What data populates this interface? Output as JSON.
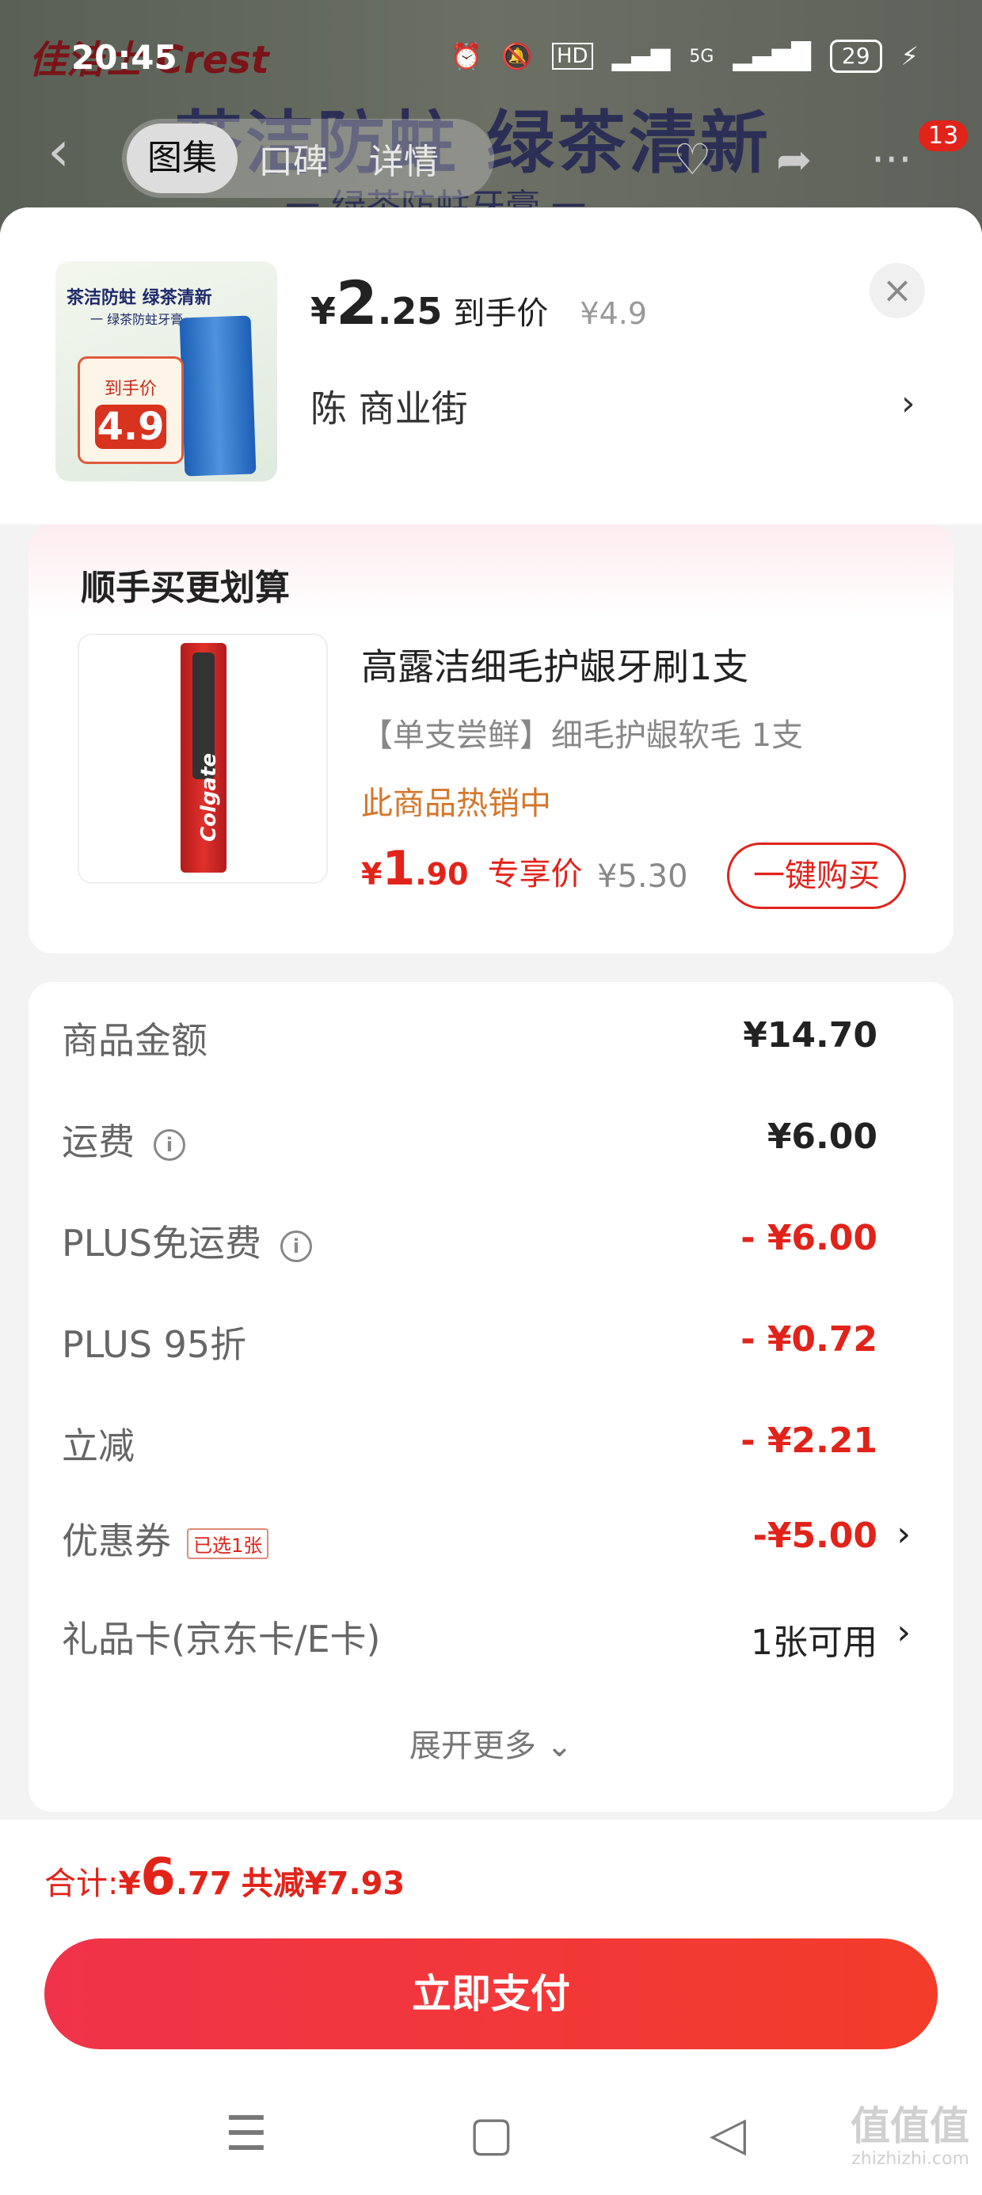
{
  "background": {
    "brand": "佳洁士 Crest",
    "banner": "茶洁防蛀  绿茶清新",
    "banner_sub": "一 绿茶防蛀牙膏 一"
  },
  "statusbar": {
    "time": "20:45",
    "battery": "29",
    "network": "5G"
  },
  "topnav": {
    "tabs": [
      "图集",
      "口碑",
      "详情"
    ],
    "active_tab": "图集",
    "badge": "13"
  },
  "product": {
    "image_title": "茶洁防蛀 绿茶清新",
    "image_sub": "一 绿茶防蛀牙膏 一",
    "image_tag_label": "到手价",
    "image_tag_price": "4.9",
    "price_yen": "¥",
    "price_int": "2",
    "price_dec": ".25",
    "price_label": "到手价",
    "original_price": "¥4.9",
    "address": "陈  商业街"
  },
  "combo": {
    "title": "顺手买更划算",
    "name": "高露洁细毛护龈牙刷1支",
    "desc": "【单支尝鲜】细毛护龈软毛 1支",
    "hot": "此商品热销中",
    "price_yen": "¥",
    "price_int": "1",
    "price_dec": ".90",
    "price_label": "专享价",
    "original_price": "¥5.30",
    "buy_label": "一键购买",
    "brand": "Colgate"
  },
  "summary": {
    "rows": [
      {
        "label": "商品金额",
        "value": "¥14.70"
      },
      {
        "label": "运费",
        "value": "¥6.00"
      },
      {
        "label": "PLUS免运费",
        "value": "- ¥6.00"
      },
      {
        "label": "PLUS 95折",
        "value": "- ¥0.72"
      },
      {
        "label": "立减",
        "value": "- ¥2.21"
      },
      {
        "label": "优惠券",
        "tag": "已选1张",
        "value": "-¥5.00"
      },
      {
        "label": "礼品卡(京东卡/E卡)",
        "value": "1张可用"
      }
    ],
    "expand_label": "展开更多 ⌄"
  },
  "total": {
    "label": "合计: ",
    "yen": "¥",
    "int": "6",
    "dec": ".77",
    "saved": "共减¥7.93"
  },
  "pay_button": "立即支付",
  "watermark": {
    "main": "值值值",
    "sub": "zhizhizhi.com"
  },
  "colors": {
    "accent_red": "#e2231a",
    "hot_orange": "#d4772c"
  }
}
